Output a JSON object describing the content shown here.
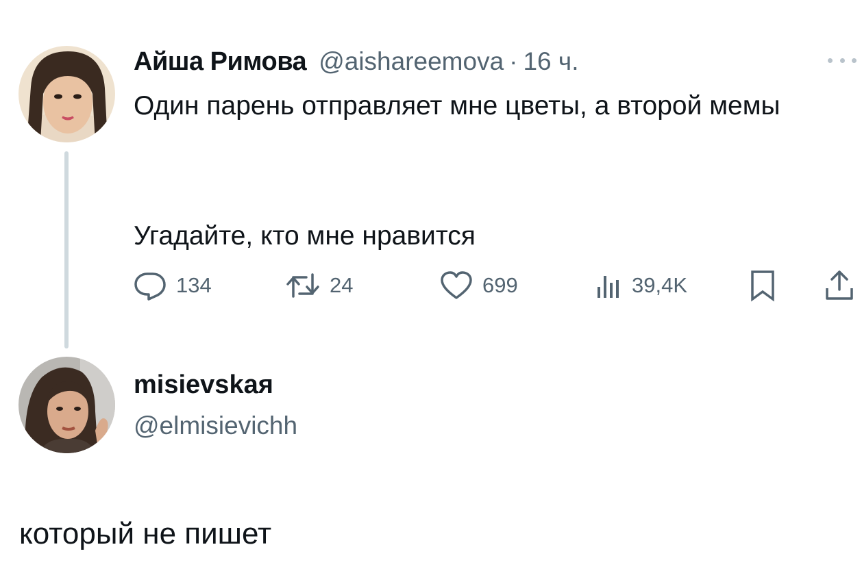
{
  "tweet": {
    "author_name": "Айша Римова",
    "author_handle": "@aishareemova",
    "separator": "·",
    "time": "16 ч.",
    "text_line1": "Один парень отправляет мне цветы, а второй мемы",
    "text_line2": "Угадайте, кто мне нравится",
    "stats": {
      "replies": "134",
      "retweets": "24",
      "likes": "699",
      "views": "39,4K"
    },
    "icons": {
      "reply": "reply-icon",
      "retweet": "retweet-icon",
      "like": "heart-icon",
      "views": "views-icon",
      "bookmark": "bookmark-icon",
      "share": "share-icon",
      "more": "more-icon"
    }
  },
  "reply": {
    "author_name": "misievskaя",
    "author_handle": "@elmisievichh",
    "text": "который не пишет"
  },
  "colors": {
    "text_primary": "#0f1419",
    "text_secondary": "#536471",
    "thread_line": "#cfd9de",
    "background": "#ffffff"
  }
}
